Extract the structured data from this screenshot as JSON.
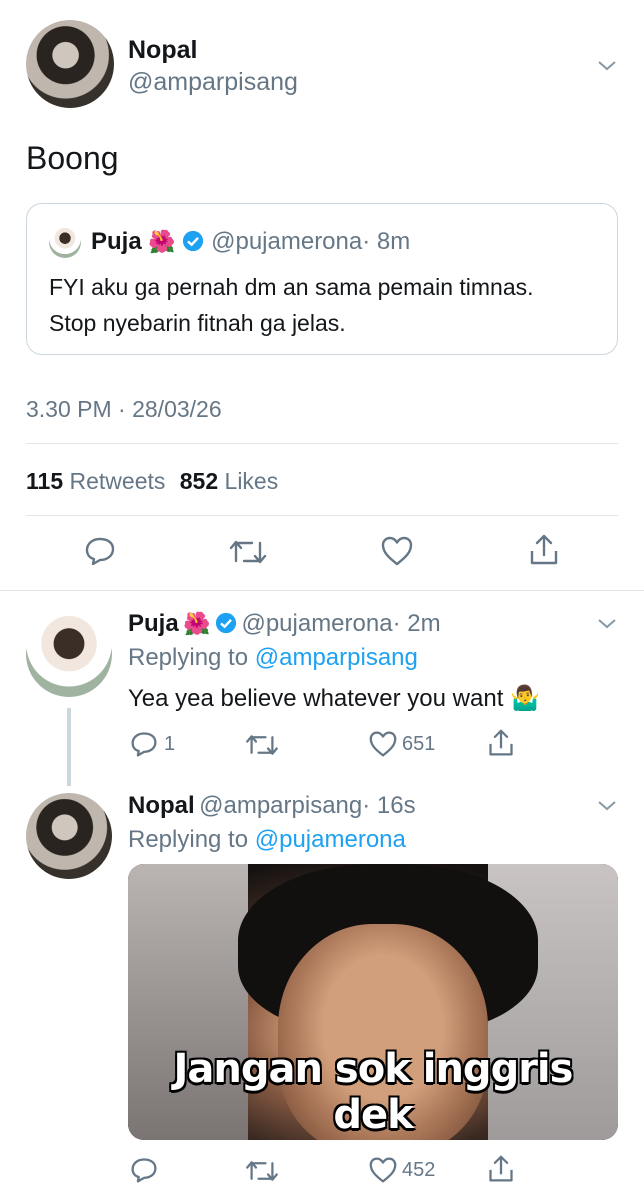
{
  "main_tweet": {
    "name": "Nopal",
    "handle": "@amparpisang",
    "text": "Boong",
    "timestamp": "3.30 PM · 28/03/26",
    "retweets_count": "115",
    "retweets_label": "Retweets",
    "likes_count": "852",
    "likes_label": "Likes"
  },
  "quoted_tweet": {
    "name": "Puja",
    "handle": "@pujamerona",
    "time": "· 8m",
    "text_line1": "FYI aku ga pernah dm an sama pemain timnas.",
    "text_line2": "Stop nyebarin fitnah ga jelas."
  },
  "reply1": {
    "name": "Puja",
    "handle": "@pujamerona",
    "time": "· 2m",
    "replying_prefix": "Replying to",
    "replying_to": "@amparpisang",
    "text": "Yea yea believe whatever you want 🤷‍♂️",
    "reply_count": "1",
    "like_count": "651"
  },
  "reply2": {
    "name": "Nopal",
    "handle": "@amparpisang",
    "time": "· 16s",
    "replying_prefix": "Replying to",
    "replying_to": "@pujamerona",
    "meme_caption": "Jangan sok inggris dek",
    "like_count": "452"
  },
  "colors": {
    "accent": "#1da1f2",
    "muted": "#657786",
    "divider": "#e1e8ed",
    "like_heart": "#657786"
  }
}
